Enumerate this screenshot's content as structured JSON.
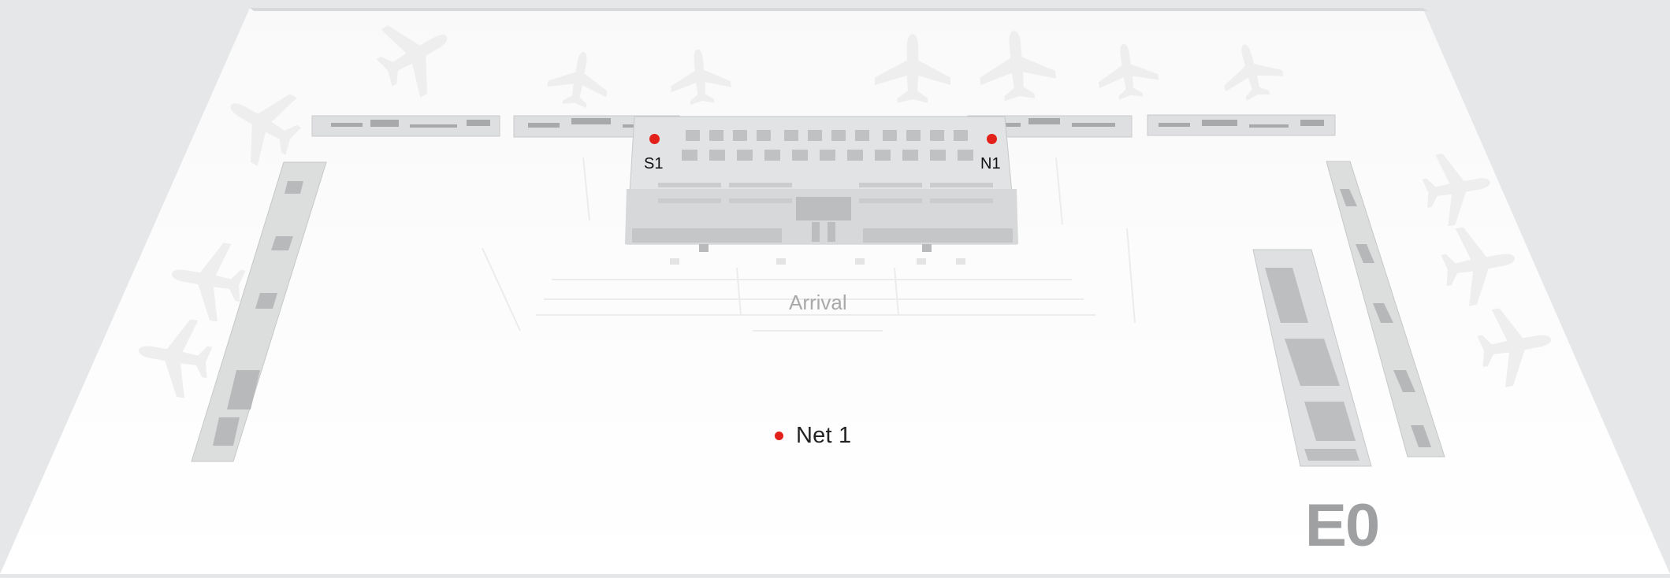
{
  "map": {
    "area_label": "Arrival",
    "level_label": "E0",
    "accent_color": "#e3211b"
  },
  "markers": [
    {
      "id": "S1",
      "label": "S1"
    },
    {
      "id": "N1",
      "label": "N1"
    }
  ],
  "legend": {
    "items": [
      {
        "label": "Net 1",
        "color": "#e3211b"
      }
    ]
  },
  "icons": [
    "airplane-icon",
    "marker-dot-icon"
  ]
}
